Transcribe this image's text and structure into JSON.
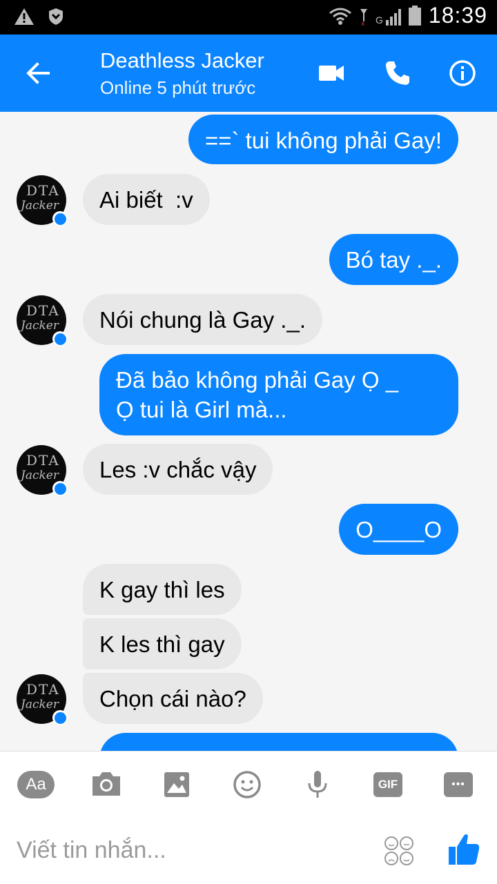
{
  "status_bar": {
    "time": "18:39",
    "network": "G"
  },
  "header": {
    "title": "Deathless Jacker",
    "subtitle": "Online 5 phút trước"
  },
  "avatar": {
    "line1": "DTA",
    "line2": "Jacker"
  },
  "messages": [
    {
      "dir": "out",
      "text": "==` tui không phải Gay!"
    },
    {
      "dir": "in",
      "text": "Ai biết  :v"
    },
    {
      "dir": "out",
      "text": "Bó tay ._."
    },
    {
      "dir": "in",
      "text": "Nói chung là Gay ._."
    },
    {
      "dir": "out",
      "text": "Đã bảo không phải Gay Ọ _\nỌ tui là Girl mà..."
    },
    {
      "dir": "in",
      "text": "Les :v chắc vậy"
    },
    {
      "dir": "out",
      "text": "O____O"
    },
    {
      "dir": "in",
      "text": "K gay thì les"
    },
    {
      "dir": "in",
      "text": "K les thì gay"
    },
    {
      "dir": "in",
      "text": "Chọn cái nào?"
    }
  ],
  "composer": {
    "placeholder": "Viết tin nhắn...",
    "toolbar": {
      "text_label": "Aa",
      "gif_label": "GIF",
      "more_label": "•••"
    }
  },
  "colors": {
    "accent": "#0a84ff",
    "incoming": "#e8e8e8"
  }
}
